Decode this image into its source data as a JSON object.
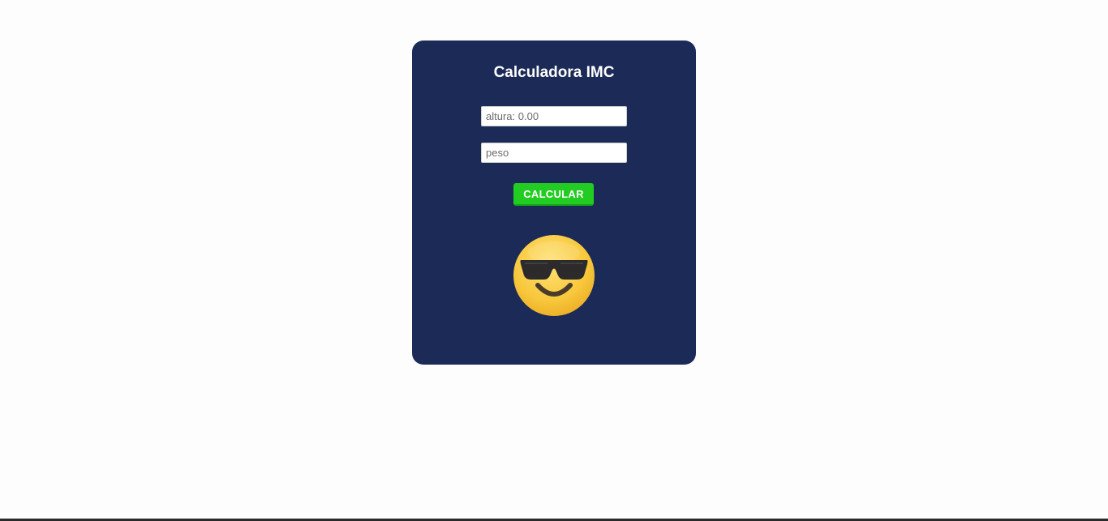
{
  "card": {
    "title": "Calculadora IMC",
    "altura": {
      "placeholder": "altura: 0.00",
      "value": ""
    },
    "peso": {
      "placeholder": "peso",
      "value": ""
    },
    "calculate_label": "CALCULAR",
    "result_icon": "smiling-face-with-sunglasses-icon"
  },
  "colors": {
    "card_background": "#1b2a56",
    "button_background": "#22cc22",
    "title_text": "#ffffff"
  }
}
